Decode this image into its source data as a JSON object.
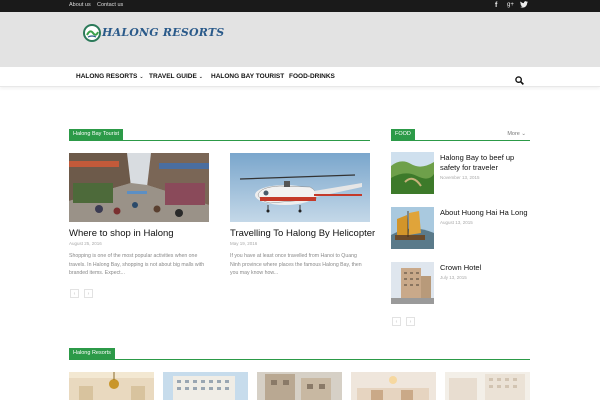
{
  "topbar": {
    "links": [
      "About us",
      "Contact us"
    ],
    "social_icons": [
      "facebook-icon",
      "google-plus-icon",
      "twitter-icon"
    ]
  },
  "brand": {
    "logo_text": "HALONG RESORTS",
    "accent": "#2c9a48"
  },
  "nav": {
    "items": [
      {
        "label": "HALONG RESORTS",
        "has_dropdown": true
      },
      {
        "label": "TRAVEL GUIDE",
        "has_dropdown": true
      },
      {
        "label": "HALONG BAY TOURIST",
        "has_dropdown": false
      },
      {
        "label": "FOOD-DRINKS",
        "has_dropdown": false
      }
    ],
    "search_icon": "search-icon"
  },
  "tourist_section": {
    "title": "Halong Bay Tourist",
    "posts": [
      {
        "title": "Where to shop in Halong",
        "date": "August 25, 2016",
        "excerpt": "Shopping is one of the most popular activities when one travels. In Halong Bay, shopping is not about big malls with branded items. Expect..."
      },
      {
        "title": "Travelling To Halong By Helicopter",
        "date": "May 19, 2016",
        "excerpt": "If you have at least once travelled from Hanoi to Quang Ninh province where places the famous Halong Bay, then you may know how..."
      }
    ],
    "pager": [
      "‹",
      "›"
    ]
  },
  "food_section": {
    "title": "FOOD",
    "more": "More",
    "posts": [
      {
        "title": "Halong Bay to beef up safety for traveler",
        "date": "November 13, 2015"
      },
      {
        "title": "About Huong Hai Ha Long",
        "date": "August 13, 2015"
      },
      {
        "title": "Crown Hotel",
        "date": "July 13, 2015"
      }
    ],
    "pager": [
      "‹",
      "›"
    ]
  },
  "resorts_section": {
    "title": "Halong Resorts"
  }
}
